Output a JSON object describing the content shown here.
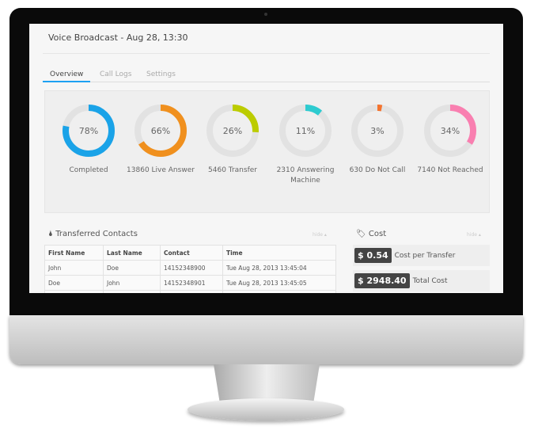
{
  "header": {
    "title": "Voice Broadcast - Aug 28, 13:30"
  },
  "tabs": [
    {
      "label": "Overview",
      "active": true
    },
    {
      "label": "Call Logs"
    },
    {
      "label": "Settings"
    }
  ],
  "stats": [
    {
      "percent": 78,
      "text": "78%",
      "label": "Completed",
      "color": "#1aa3e8"
    },
    {
      "percent": 66,
      "text": "66%",
      "label": "13860 Live Answer",
      "color": "#f0901e"
    },
    {
      "percent": 26,
      "text": "26%",
      "label": "5460 Transfer",
      "color": "#bccc00"
    },
    {
      "percent": 11,
      "text": "11%",
      "label": "2310 Answering Machine",
      "color": "#2ecbd0"
    },
    {
      "percent": 3,
      "text": "3%",
      "label": "630 Do Not Call",
      "color": "#f4732e"
    },
    {
      "percent": 34,
      "text": "34%",
      "label": "7140 Not Reached",
      "color": "#f97fb0"
    }
  ],
  "contacts": {
    "title": "Transferred Contacts",
    "hide": "hide ▴",
    "columns": [
      "First Name",
      "Last Name",
      "Contact",
      "Time"
    ],
    "rows": [
      [
        "John",
        "Doe",
        "14152348900",
        "Tue Aug 28, 2013 13:45:04"
      ],
      [
        "Doe",
        "John",
        "14152348901",
        "Tue Aug 28, 2013 13:45:05"
      ],
      [
        "",
        "",
        "",
        ""
      ]
    ]
  },
  "cost": {
    "title": "Cost",
    "hide": "hide ▴",
    "items": [
      {
        "value": "$ 0.54",
        "label": "Cost per Transfer"
      },
      {
        "value": "$ 2948.40",
        "label": "Total Cost"
      }
    ]
  }
}
